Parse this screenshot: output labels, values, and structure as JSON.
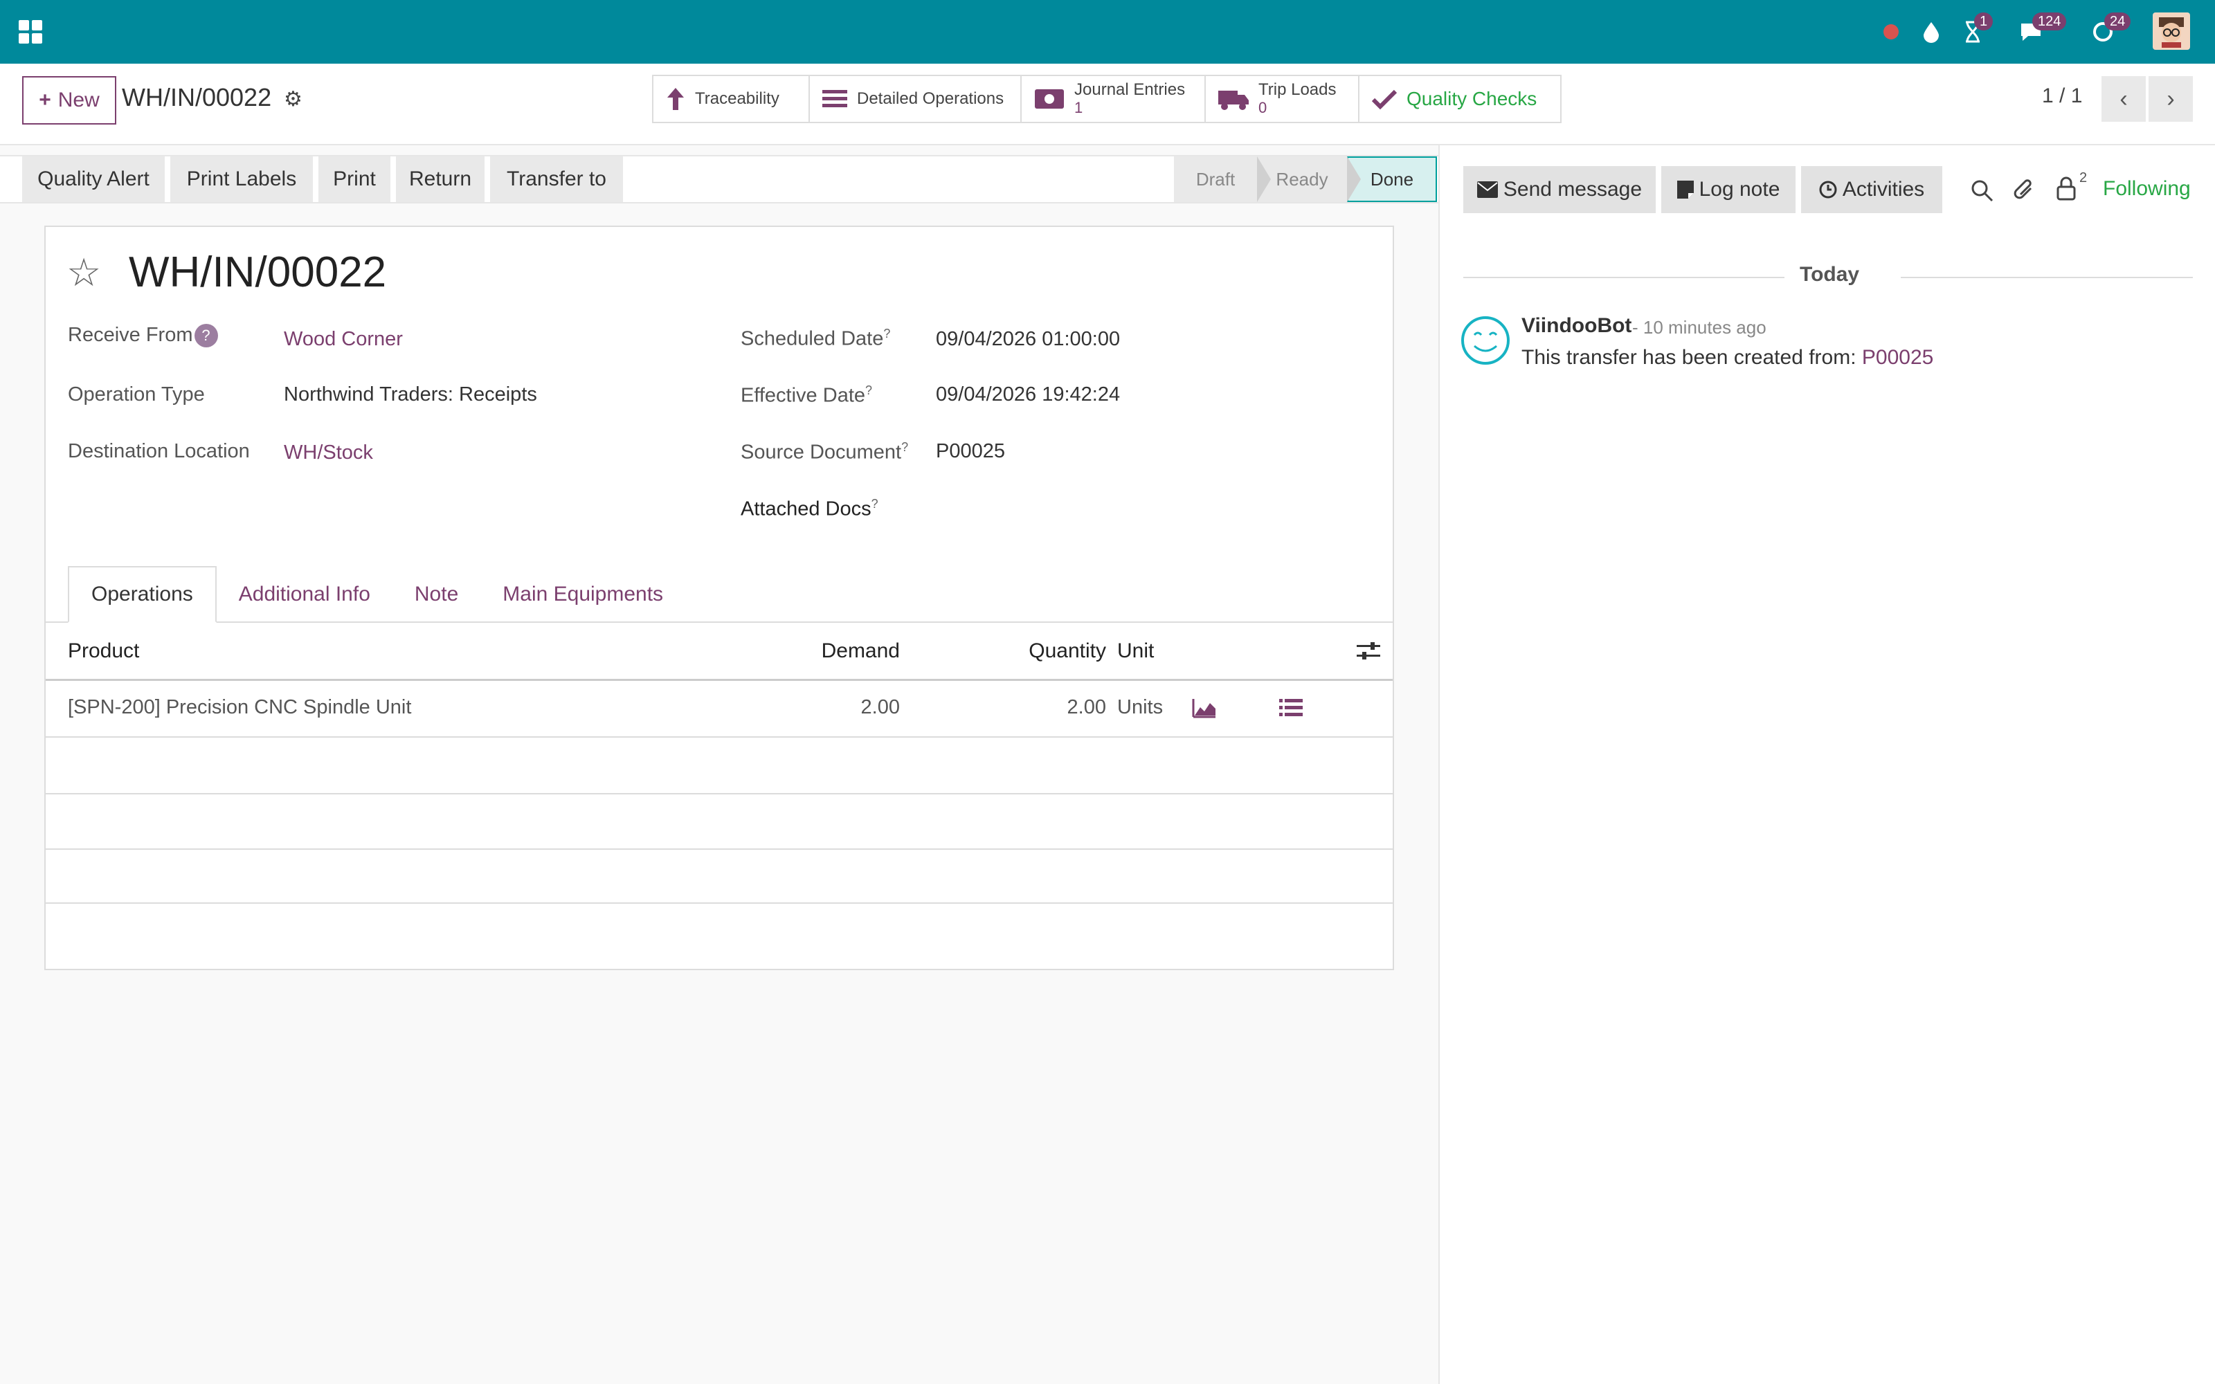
{
  "navbar": {
    "badges": {
      "activities": "1",
      "messages": "124",
      "updates": "24"
    }
  },
  "control": {
    "new_label": "New",
    "record_ref": "WH/IN/00022",
    "smart": {
      "traceability": "Traceability",
      "detailed_operations": "Detailed Operations",
      "journal_entries": "Journal Entries",
      "journal_entries_count": "1",
      "trip_loads": "Trip Loads",
      "trip_loads_count": "0",
      "quality_checks": "Quality Checks"
    },
    "pager": "1 / 1"
  },
  "statusbar": {
    "buttons": [
      "Quality Alert",
      "Print Labels",
      "Print",
      "Return",
      "Transfer to"
    ],
    "stages": [
      "Draft",
      "Ready",
      "Done"
    ],
    "current_stage": "Done"
  },
  "form": {
    "name": "WH/IN/00022",
    "fields": {
      "receive_from_label": "Receive From",
      "receive_from": "Wood Corner",
      "operation_type_label": "Operation Type",
      "operation_type": "Northwind Traders: Receipts",
      "destination_label": "Destination Location",
      "destination": "WH/Stock",
      "scheduled_label": "Scheduled Date",
      "scheduled": "09/04/2026 01:00:00",
      "effective_label": "Effective Date",
      "effective": "09/04/2026 19:42:24",
      "source_label": "Source Document",
      "source": "P00025",
      "attached_label": "Attached Docs"
    },
    "tabs": [
      "Operations",
      "Additional Info",
      "Note",
      "Main Equipments"
    ],
    "table": {
      "headers": {
        "product": "Product",
        "demand": "Demand",
        "quantity": "Quantity",
        "unit": "Unit"
      },
      "rows": [
        {
          "product": "[SPN-200] Precision CNC Spindle Unit",
          "demand": "2.00",
          "quantity": "2.00",
          "unit": "Units"
        }
      ]
    }
  },
  "chatter": {
    "send_message": "Send message",
    "log_note": "Log note",
    "activities": "Activities",
    "followers_count": "2",
    "following": "Following",
    "today": "Today",
    "message": {
      "author": "ViindooBot",
      "time": "- 10 minutes ago",
      "text": "This transfer has been created from:",
      "link": "P00025"
    }
  },
  "colors": {
    "navbar": "#00899b",
    "brand": "#7b3f6e",
    "success": "#28a745",
    "done_stage": "#00a09d"
  }
}
